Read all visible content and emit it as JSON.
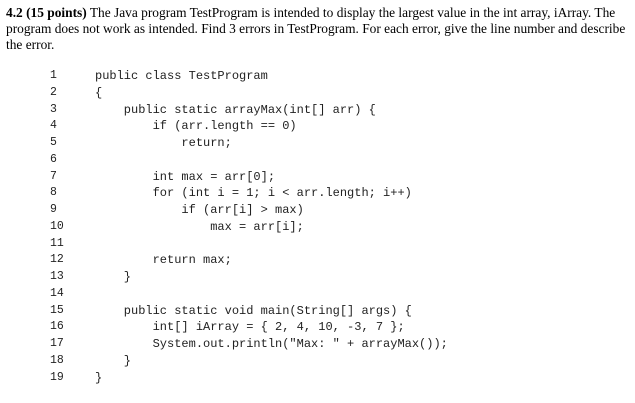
{
  "question": {
    "number": "4.2 (15 points)",
    "text": " The Java program TestProgram is intended to display the largest value in the int array, iArray. The program does not work as intended. Find 3 errors in TestProgram. For each error, give the line number and describe the error."
  },
  "code_lines": [
    {
      "num": "1",
      "text": "public class TestProgram"
    },
    {
      "num": "2",
      "text": "{"
    },
    {
      "num": "3",
      "text": "    public static arrayMax(int[] arr) {"
    },
    {
      "num": "4",
      "text": "        if (arr.length == 0)"
    },
    {
      "num": "5",
      "text": "            return;"
    },
    {
      "num": "6",
      "text": ""
    },
    {
      "num": "7",
      "text": "        int max = arr[0];"
    },
    {
      "num": "8",
      "text": "        for (int i = 1; i < arr.length; i++)"
    },
    {
      "num": "9",
      "text": "            if (arr[i] > max)"
    },
    {
      "num": "10",
      "text": "                max = arr[i];"
    },
    {
      "num": "11",
      "text": ""
    },
    {
      "num": "12",
      "text": "        return max;"
    },
    {
      "num": "13",
      "text": "    }"
    },
    {
      "num": "14",
      "text": ""
    },
    {
      "num": "15",
      "text": "    public static void main(String[] args) {"
    },
    {
      "num": "16",
      "text": "        int[] iArray = { 2, 4, 10, -3, 7 };"
    },
    {
      "num": "17",
      "text": "        System.out.println(\"Max: \" + arrayMax());"
    },
    {
      "num": "18",
      "text": "    }"
    },
    {
      "num": "19",
      "text": "}"
    }
  ]
}
